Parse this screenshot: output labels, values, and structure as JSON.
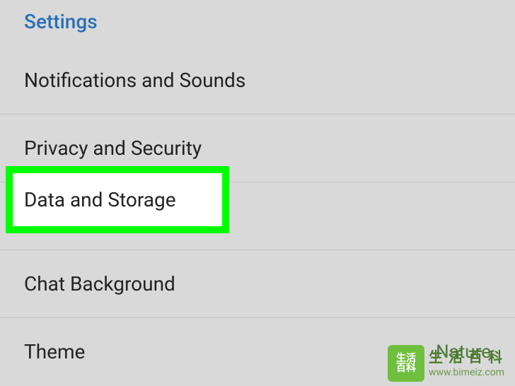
{
  "section_header": "Settings",
  "items": [
    {
      "label": "Notifications and Sounds"
    },
    {
      "label": "Privacy and Security"
    },
    {
      "label": "Data and Storage"
    },
    {
      "label": "Chat Background"
    },
    {
      "label": "Theme",
      "value": "Nature"
    }
  ],
  "highlighted_label": "Data and Storage",
  "watermark": {
    "badge_top": "生活",
    "badge_bottom": "百科",
    "line1": "生活百科",
    "line2": "www.bimeiz.com"
  }
}
